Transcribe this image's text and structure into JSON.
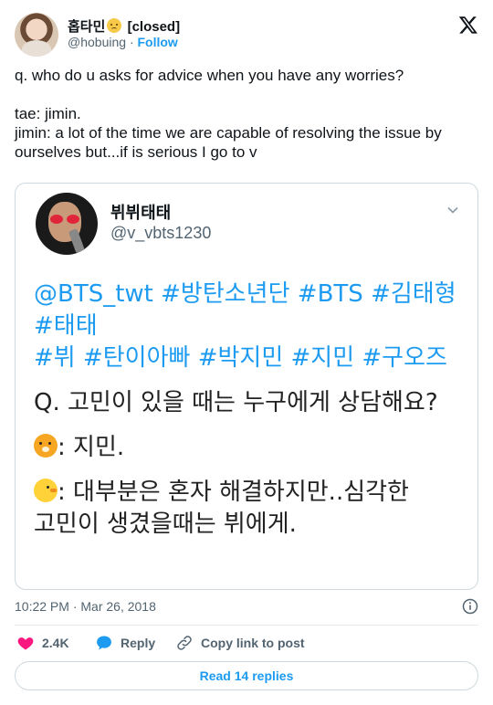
{
  "author": {
    "name": "홉타민",
    "status": "[closed]",
    "handle": "@hobuing",
    "separator": "·",
    "follow_label": "Follow",
    "avatar_icon": "avatar",
    "status_emoji": "pleading-face-icon"
  },
  "tweet": {
    "line1": "q. who do u asks for advice when you have any worries?",
    "line2": "tae: jimin.",
    "line3": "jimin: a lot of the time we are capable of resolving the issue by ourselves but...if is serious I go to v"
  },
  "quote": {
    "name": "뷔뷔태태",
    "handle": "@v_vbts1230",
    "tags_line1": "@BTS_twt #방탄소년단 #BTS #김태형",
    "tags_line2": "#태태",
    "tags_line3": "#뷔 #탄이아빠 #박지민 #지민 #구오즈",
    "question": "Q. 고민이 있을 때는 누구에게 상담해요?",
    "answer1": ": 지민.",
    "answer2_a": ": 대부분은 혼자 해결하지만..심각한",
    "answer2_b": "고민이 생겼을때는 뷔에게."
  },
  "meta": {
    "timestamp": "10:22 PM · Mar 26, 2018"
  },
  "actions": {
    "likes": "2.4K",
    "reply": "Reply",
    "copy": "Copy link to post"
  },
  "footer": {
    "read_replies": "Read 14 replies"
  },
  "colors": {
    "accent": "#1d9bf0",
    "like": "#f91880",
    "text": "#0f1419",
    "muted": "#536471",
    "border": "#cfd9de"
  }
}
